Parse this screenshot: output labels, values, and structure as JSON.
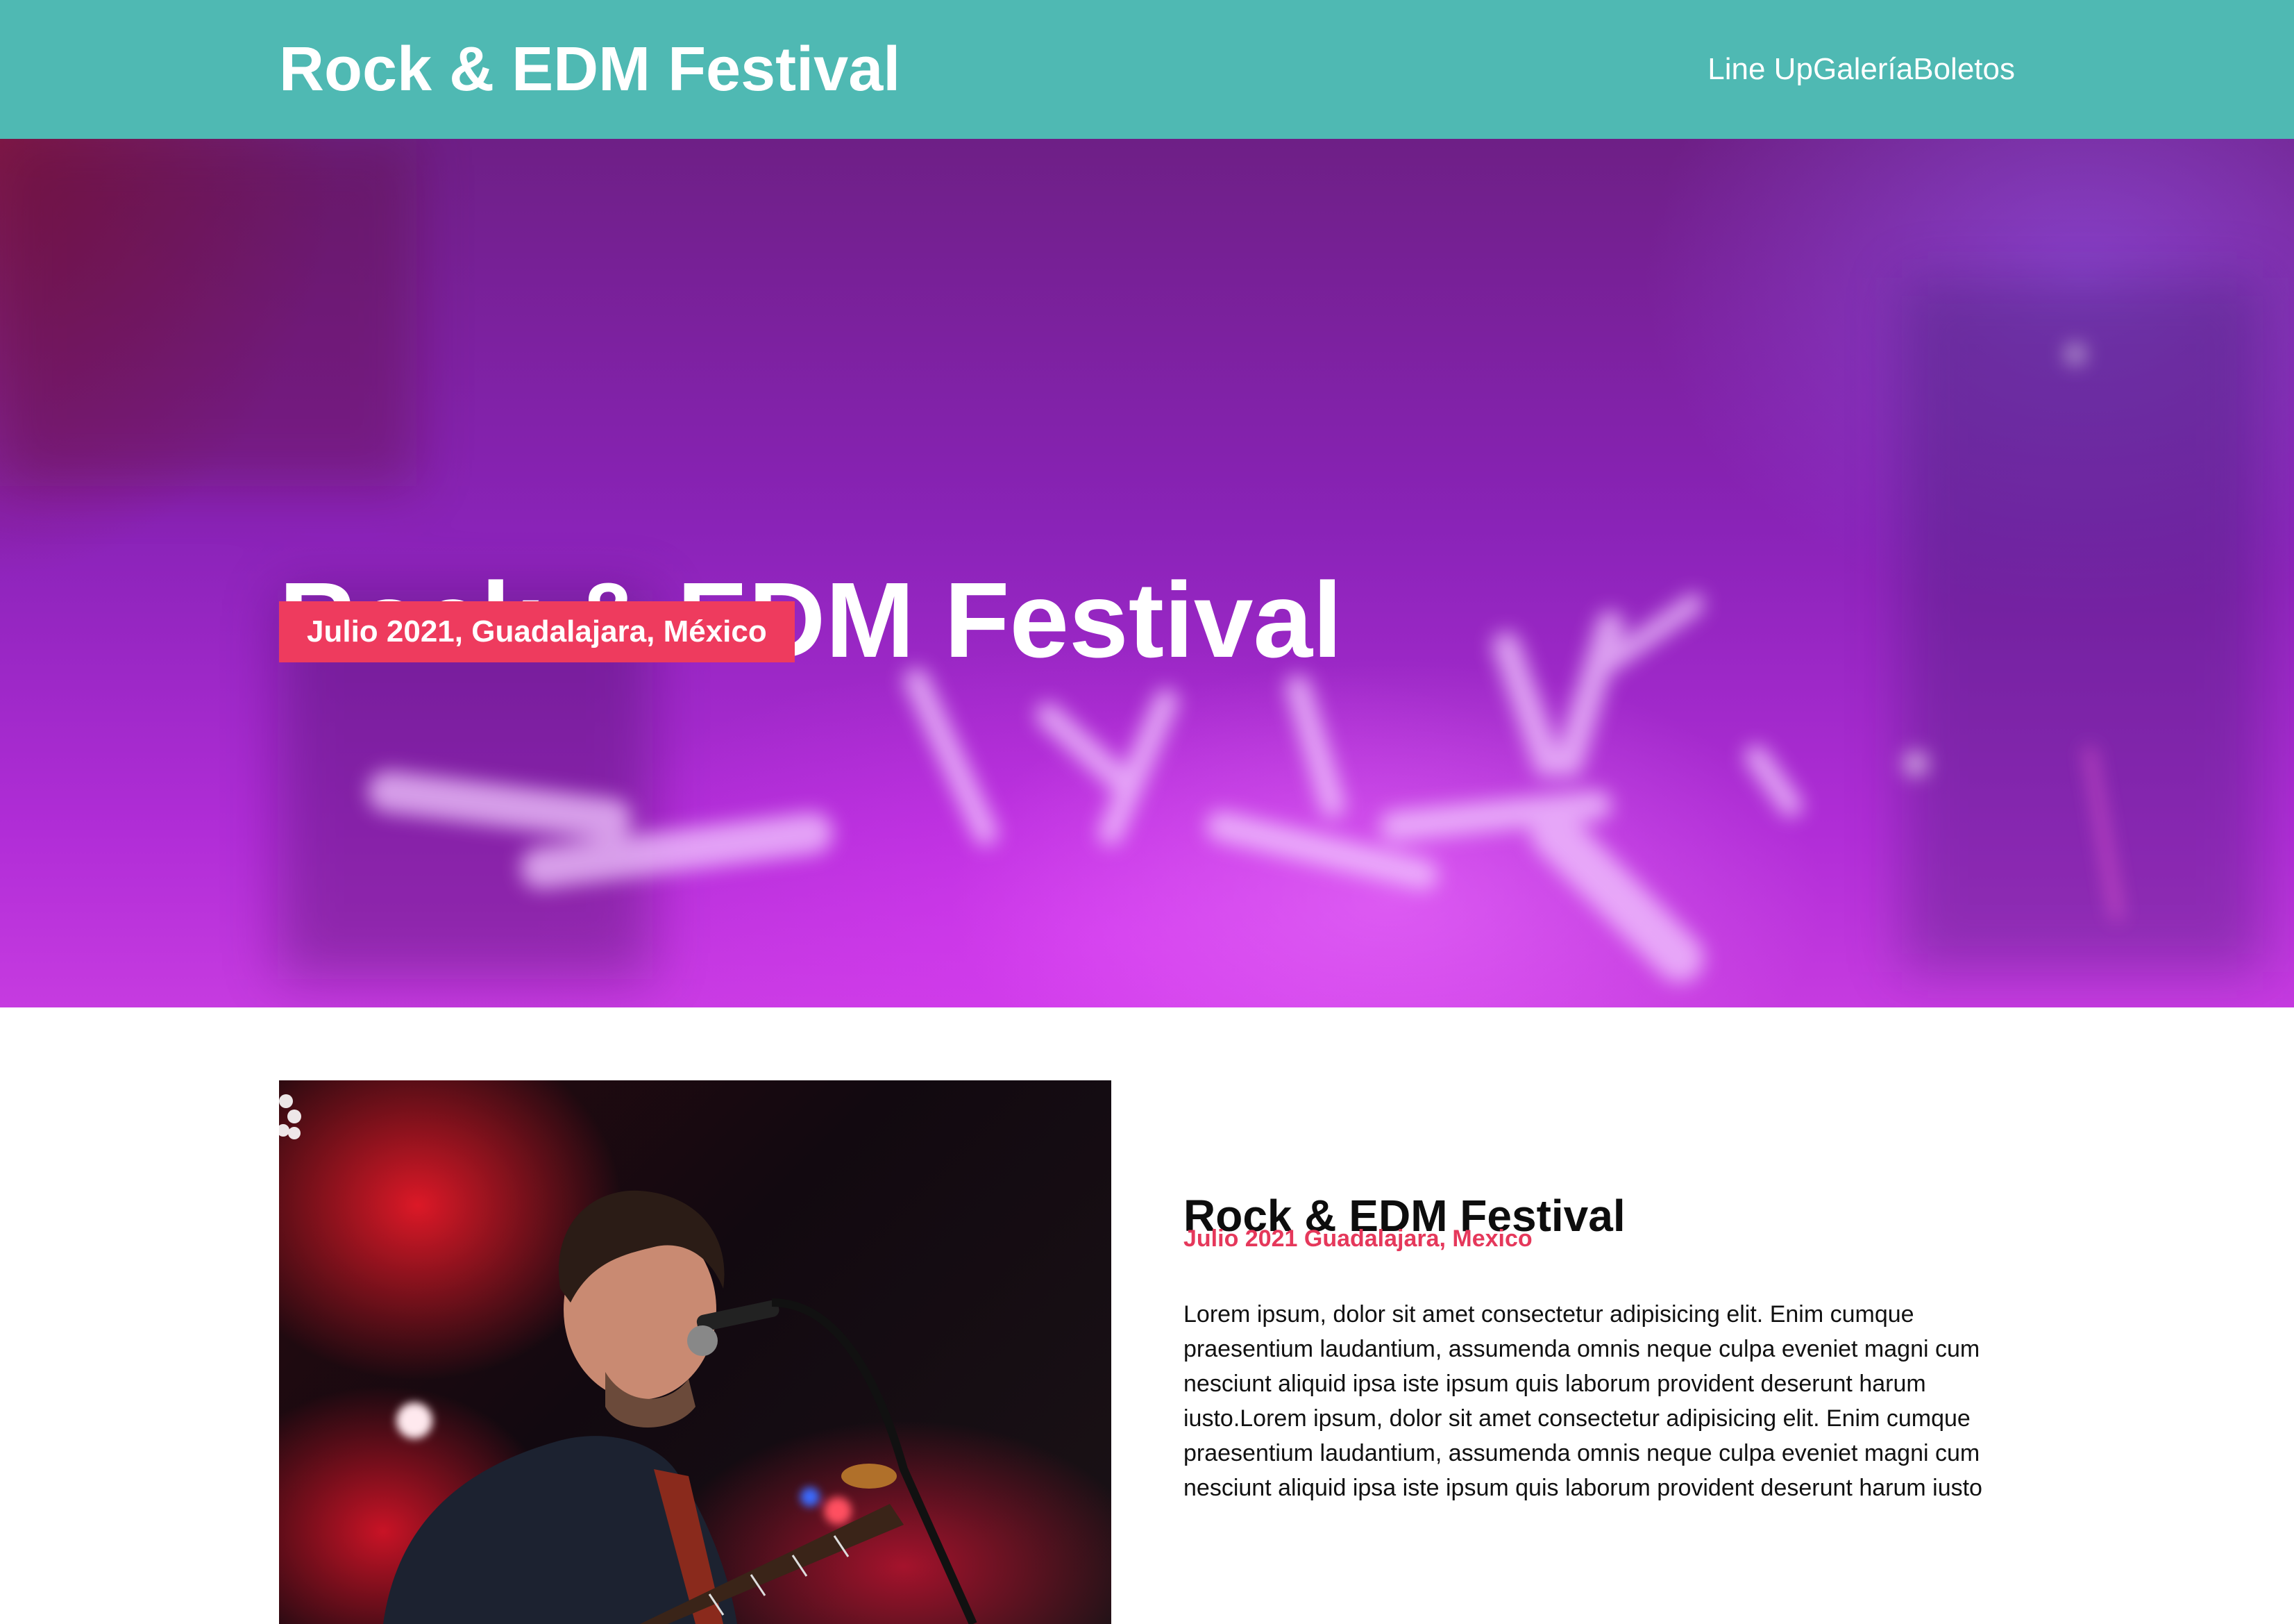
{
  "header": {
    "logo": "Rock & EDM Festival",
    "nav": [
      "Line Up",
      "Galería",
      "Boletos"
    ],
    "background_color": "#4fb9b3"
  },
  "hero": {
    "title": "Rock & EDM Festival",
    "badge": "Julio 2021, Guadalajara, México",
    "badge_color": "#ee3b5e"
  },
  "about": {
    "title": "Rock & EDM Festival",
    "subtitle": "Julio 2021 Guadalajara, Mexico",
    "subtitle_color": "#e5385b",
    "body": "Lorem ipsum, dolor sit amet consectetur adipisicing elit. Enim cumque praesentium laudantium, assumenda omnis neque culpa eveniet magni cum nesciunt aliquid ipsa iste ipsum quis laborum provident deserunt harum iusto.Lorem ipsum, dolor sit amet consectetur adipisicing elit. Enim cumque praesentium laudantium, assumenda omnis neque culpa eveniet magni cum nesciunt aliquid ipsa iste ipsum quis laborum provident deserunt harum iusto"
  }
}
